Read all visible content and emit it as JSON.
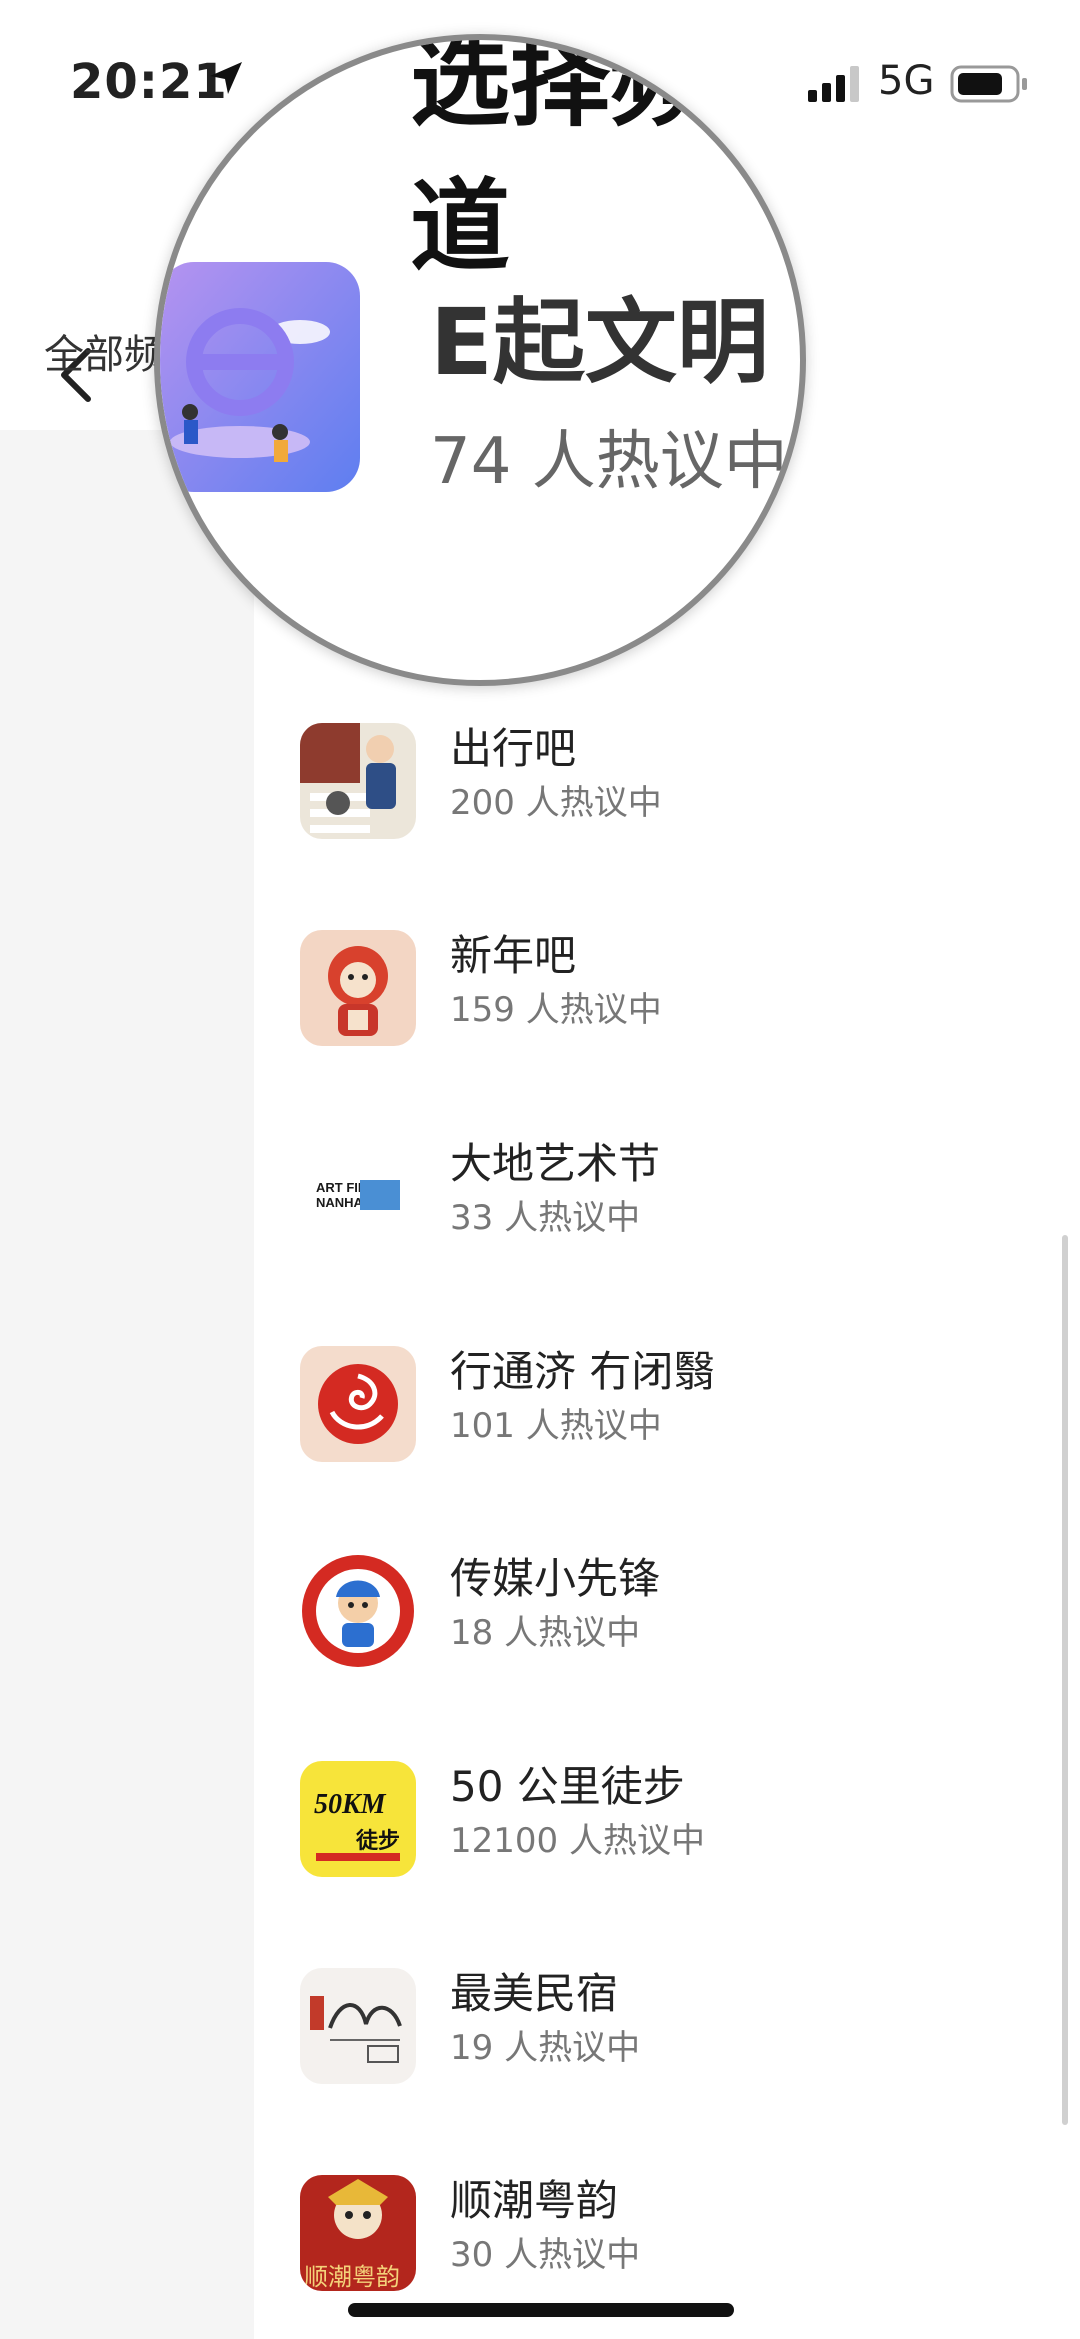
{
  "status": {
    "time": "20:21",
    "network": "5G"
  },
  "header": {
    "title": "选择频道",
    "tab_all": "全部频"
  },
  "magnifier": {
    "name": "E起文明",
    "count": "74 人热议中"
  },
  "channels": [
    {
      "name": "出行吧",
      "count": "200 人热议中",
      "icon": "travel-icon"
    },
    {
      "name": "新年吧",
      "count": "159 人热议中",
      "icon": "new-year-icon"
    },
    {
      "name": "大地艺术节",
      "count": "33 人热议中",
      "icon": "art-field-icon",
      "logo_line1": "ART FIELD",
      "logo_line2": "NANHAI 2022"
    },
    {
      "name": "行通济 冇闭翳",
      "count": "101 人热议中",
      "icon": "flower-icon"
    },
    {
      "name": "传媒小先锋",
      "count": "18 人热议中",
      "icon": "media-pioneer-icon"
    },
    {
      "name": "50 公里徒步",
      "count": "12100 人热议中",
      "icon": "hike-50km-icon",
      "logo_line1": "50KM",
      "logo_line2": "徒步"
    },
    {
      "name": "最美民宿",
      "count": "19 人热议中",
      "icon": "homestay-icon"
    },
    {
      "name": "顺潮粤韵",
      "count": "30 人热议中",
      "icon": "opera-icon",
      "logo_line1": "顺潮粤韵"
    }
  ],
  "colors": {
    "accent": "#d6231c",
    "background": "#f5f5f5"
  }
}
